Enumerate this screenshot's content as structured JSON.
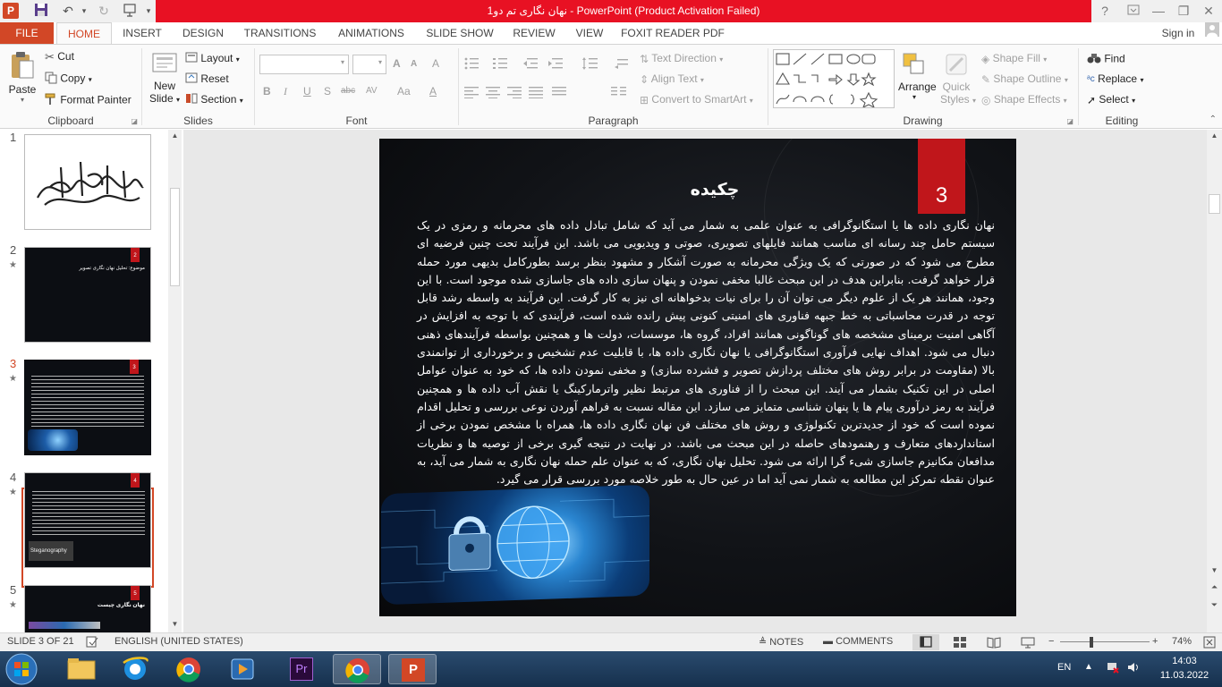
{
  "window": {
    "title": "نهان نگاری  تم دو1  -  PowerPoint (Product Activation Failed)",
    "help": "?",
    "minimize": "—",
    "restore": "❐",
    "close": "✕"
  },
  "tabs": {
    "file": "FILE",
    "items": [
      "HOME",
      "INSERT",
      "DESIGN",
      "TRANSITIONS",
      "ANIMATIONS",
      "SLIDE SHOW",
      "REVIEW",
      "VIEW",
      "FOXIT READER PDF"
    ],
    "signin": "Sign in"
  },
  "ribbon": {
    "clipboard": {
      "paste": "Paste",
      "cut": "Cut",
      "copy": "Copy",
      "format_painter": "Format Painter",
      "label": "Clipboard"
    },
    "slides": {
      "new_slide_1": "New",
      "new_slide_2": "Slide",
      "layout": "Layout",
      "reset": "Reset",
      "section": "Section",
      "label": "Slides"
    },
    "font": {
      "label": "Font",
      "bold": "B",
      "italic": "I",
      "underline": "U",
      "shadow": "S",
      "strike": "abc",
      "spacing": "AV",
      "case": "Aa",
      "color": "A",
      "grow": "A",
      "shrink": "A",
      "clear": "A"
    },
    "paragraph": {
      "label": "Paragraph",
      "text_direction": "Text Direction",
      "align_text": "Align Text",
      "convert_smartart": "Convert to SmartArt"
    },
    "drawing": {
      "label": "Drawing",
      "arrange": "Arrange",
      "quick_styles_1": "Quick",
      "quick_styles_2": "Styles",
      "shape_fill": "Shape Fill",
      "shape_outline": "Shape Outline",
      "shape_effects": "Shape Effects"
    },
    "editing": {
      "label": "Editing",
      "find": "Find",
      "replace": "Replace",
      "select": "Select"
    }
  },
  "thumbnails": {
    "numbers": [
      "1",
      "2",
      "3",
      "4",
      "5"
    ],
    "star": "★",
    "slide2_title": "موضوع: تحلیل نهان نگاری تصویر",
    "slide2_num": "2",
    "slide3_num": "3",
    "slide4_num": "4",
    "slide4_caption": "Steganography",
    "slide5_num": "5",
    "slide5_title": "نهان نگاری چیست"
  },
  "slide": {
    "title": "چکیده",
    "number": "3",
    "body": "نهان نگاری داده ها یا استگانوگرافی به عنوان علمی به شمار می آید که شامل تبادل داده های محرمانه و رمزی در یک سیستم حامل چند رسانه ای مناسب همانند فایلهای تصویری، صوتی و ویدیویی می باشد. این فرآیند تحت چنین فرضیه ای مطرح می شود که در صورتی که یک ویژگی محرمانه به صورت آشکار و مشهود بنظر برسد بطورکامل بدیهی مورد حمله قرار خواهد گرفت. بنابراین هدف در این مبحث غالبا مخفی نمودن و پنهان سازی داده های جاسازی شده موجود است. با این وجود، همانند هر یک از علوم دیگر می توان آن را برای نیات بدخواهانه ای نیز به کار گرفت. این فرآیند به واسطه رشد قابل توجه در قدرت محاسباتی به خط جبهه فناوری های امنیتی کنونی پیش رانده شده است، فرآیندی که با توجه به افزایش در آگاهی امنیت برمبنای مشخصه های گوناگونی همانند افراد، گروه ها، موسسات، دولت ها و همچنین بواسطه فرآیندهای ذهنی دنبال می شود. اهداف نهایی فرآوری استگانوگرافی یا نهان نگاری داده ها، با قابلیت عدم تشخیص و برخورداری از توانمندی بالا (مقاومت در برابر روش های مختلف پردازش تصویر و فشرده سازی) و مخفی نمودن داده ها، که خود به عنوان عوامل اصلی در این تکنیک بشمار می آیند. این مبحث را از فناوری های مرتبط نظیر واترمارکینگ یا نقش آب داده ها و همچنین فرآیند به رمز درآوری پیام ها یا پنهان شناسی متمایز می سازد. این مقاله نسبت به فراهم آوردن نوعی بررسی و تحلیل اقدام نموده است که خود از جدیدترین تکنولوژی و روش های مختلف فن نهان نگاری داده ها، همراه با مشخص نمودن برخی از استانداردهای متعارف و رهنمودهای حاصله در این مبحث می باشد. در نهایت در نتیجه گیری برخی از توصیه ها و نظریات مدافعان مکانیزم جاسازی شیء گرا ارائه می شود. تحلیل نهان نگاری، که به عنوان علم حمله نهان نگاری به شمار می آید، به عنوان نقطه تمرکز این مطالعه به شمار نمی آید اما در عین حال به طور خلاصه مورد بررسی قرار می گیرد."
  },
  "statusbar": {
    "slide_info": "SLIDE 3 OF 21",
    "language": "ENGLISH (UNITED STATES)",
    "notes": "NOTES",
    "comments": "COMMENTS",
    "zoom_minus": "−",
    "zoom_plus": "+",
    "zoom": "74%"
  },
  "taskbar": {
    "lang": "EN",
    "time": "14:03",
    "date": "11.03.2022",
    "premiere": "Pr",
    "ppt": "P"
  },
  "colors": {
    "accent": "#d24726",
    "title_red": "#e81123",
    "slide_number_box": "#c0161b"
  }
}
